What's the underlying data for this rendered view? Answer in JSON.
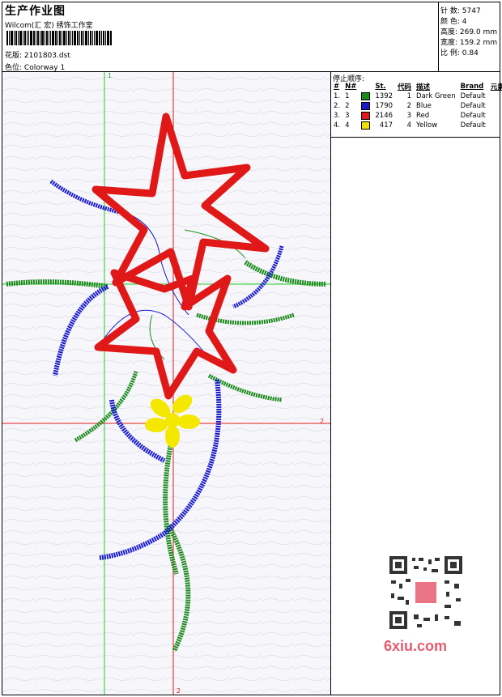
{
  "header": {
    "title": "生产作业图",
    "subtitle": "Wilcom(汇 宏) 绣饰工作室",
    "file_label": "花版:",
    "file_value": "2101803.dst",
    "colorway_label": "色位:",
    "colorway_value": "Colorway 1"
  },
  "stats": {
    "stitches_label": "针 数:",
    "stitches_value": "5747",
    "colors_label": "颜 色:",
    "colors_value": "4",
    "height_label": "高度:",
    "height_value": "269.0 mm",
    "width_label": "宽度:",
    "width_value": "159.2 mm",
    "scale_label": "比 例:",
    "scale_value": "0.84"
  },
  "stop_sequence": {
    "title": "停止顺序:",
    "headers": [
      "#",
      "N#",
      "St.",
      "代码",
      "描述",
      "Brand",
      "元素"
    ],
    "rows": [
      {
        "num": "1.",
        "n": "1",
        "color": "#1a8a1a",
        "st": "1392",
        "code": "1",
        "desc": "Dark Green",
        "brand": "Default"
      },
      {
        "num": "2.",
        "n": "2",
        "color": "#1a1acc",
        "st": "1790",
        "code": "2",
        "desc": "Blue",
        "brand": "Default"
      },
      {
        "num": "3.",
        "n": "3",
        "color": "#e01818",
        "st": "2146",
        "code": "3",
        "desc": "Red",
        "brand": "Default"
      },
      {
        "num": "4.",
        "n": "4",
        "color": "#f0e000",
        "st": "417",
        "code": "4",
        "desc": "Yellow",
        "brand": "Default"
      }
    ]
  },
  "guides": {
    "green_top_label": "1",
    "red_right_label": "2",
    "red_bottom_label": "2"
  },
  "watermark": {
    "logo_text": "6xiu.com"
  },
  "colors": {
    "green": "#1a8a1a",
    "blue": "#1a1acc",
    "red": "#e01818",
    "yellow": "#f5e800",
    "guide_green": "#22cc22",
    "guide_red": "#e01818"
  }
}
